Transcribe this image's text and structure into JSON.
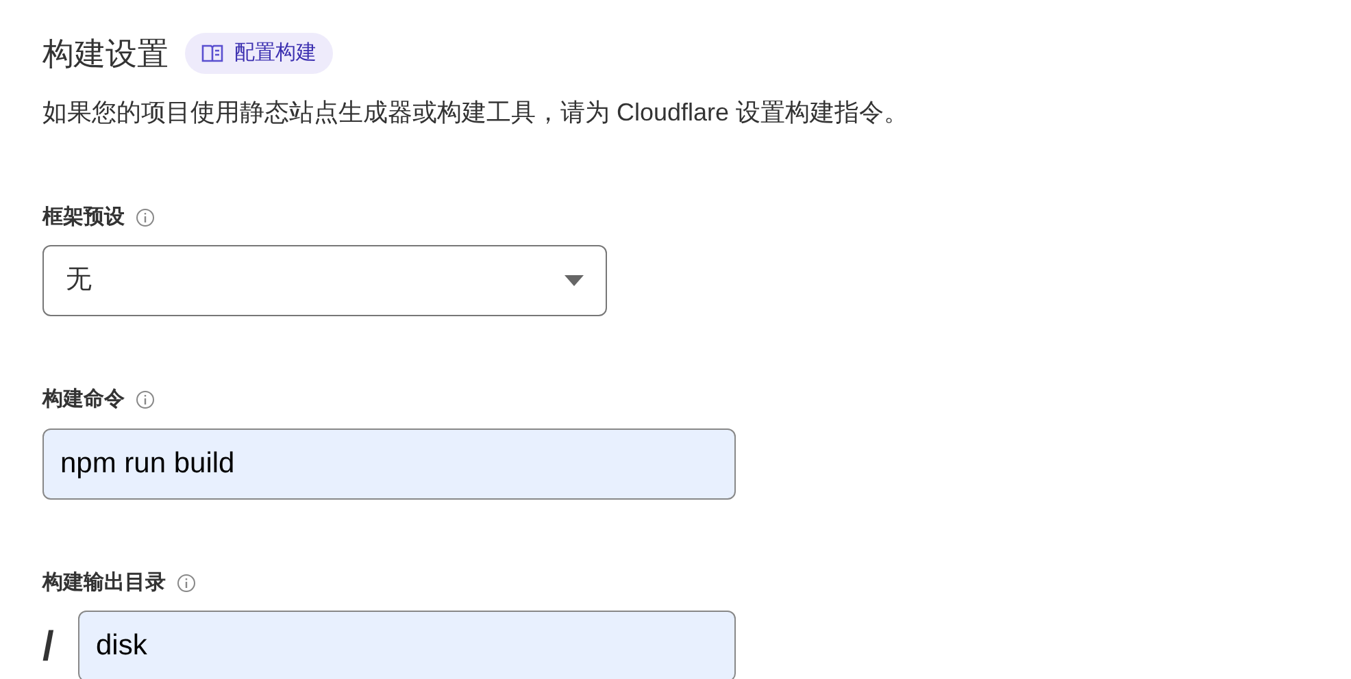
{
  "section": {
    "title": "构建设置",
    "docs_link": "配置构建",
    "description": "如果您的项目使用静态站点生成器或构建工具，请为 Cloudflare 设置构建指令。"
  },
  "fields": [
    {
      "kind": "select",
      "label": "框架预设",
      "value": "无"
    },
    {
      "kind": "input",
      "label": "构建命令",
      "value": "npm run build"
    },
    {
      "kind": "prefixed",
      "label": "构建输出目录",
      "prefix": "/",
      "value": "disk"
    }
  ]
}
